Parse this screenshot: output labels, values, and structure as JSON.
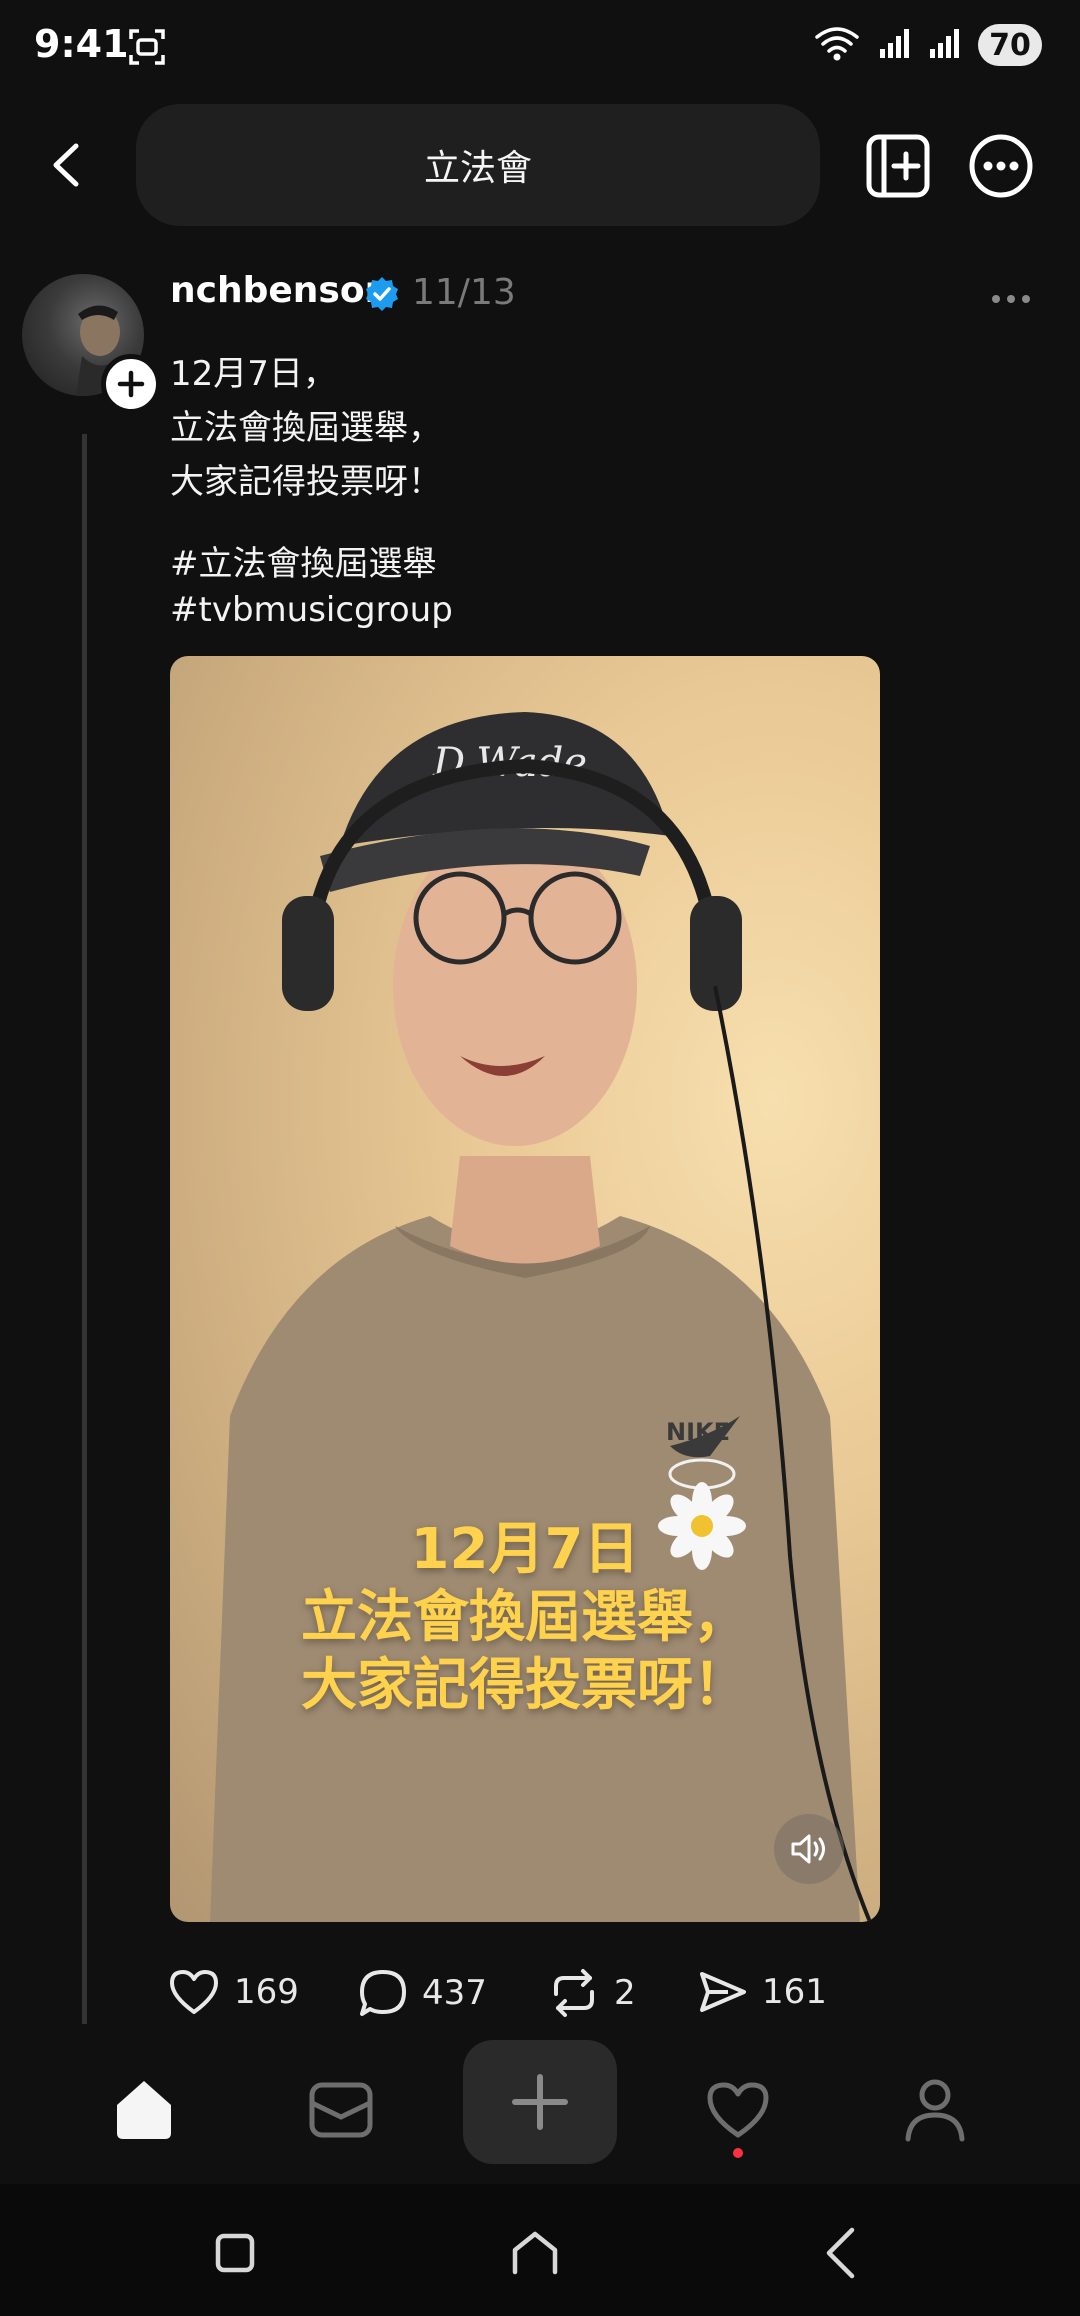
{
  "status_bar": {
    "time": "9:41",
    "battery": "70",
    "icons": [
      "screenshot-icon",
      "wifi-icon",
      "signal-icon",
      "signal-icon",
      "battery-icon"
    ]
  },
  "header": {
    "search_query": "立法會",
    "icons": [
      "back-arrow-icon",
      "add-column-icon",
      "more-circle-icon"
    ]
  },
  "post": {
    "username": "nchbenson",
    "date": "11/13",
    "text_lines": [
      "12月7日，",
      "立法會換屆選舉，",
      "大家記得投票呀！"
    ],
    "hashtags": [
      "#立法會換屆選舉",
      "#tvbmusicgroup"
    ],
    "video": {
      "overlay_lines": [
        "12月7日",
        "立法會換屆選舉，",
        "大家記得投票呀！"
      ]
    },
    "actions": {
      "likes": "169",
      "replies": "437",
      "reposts": "2",
      "shares": "161"
    }
  },
  "colors": {
    "background": "#101010",
    "verified": "#1d9bf0",
    "overlay_text": "#ffd24d",
    "notification_dot": "#ff3040"
  }
}
